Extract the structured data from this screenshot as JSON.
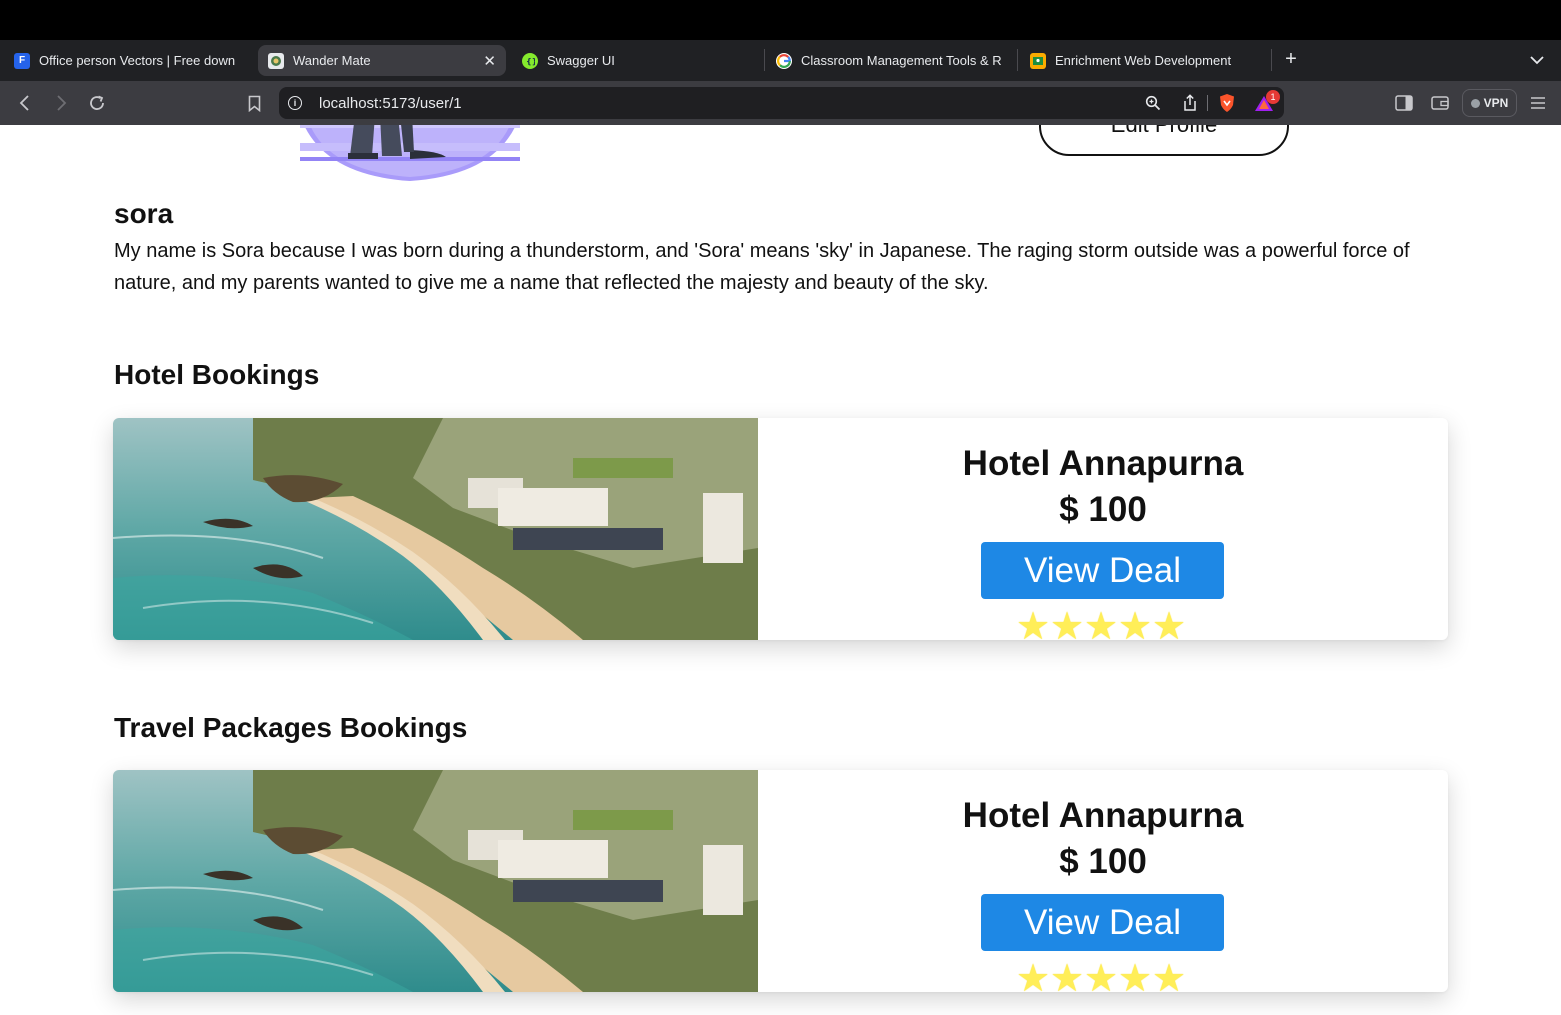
{
  "browser": {
    "tabs": [
      {
        "title": "Office person Vectors | Free down",
        "active": false,
        "favicon": "freepik-icon"
      },
      {
        "title": "Wander Mate",
        "active": true,
        "favicon": "wandermate-icon"
      },
      {
        "title": "Swagger UI",
        "active": false,
        "favicon": "swagger-icon"
      },
      {
        "title": "Classroom Management Tools & R",
        "active": false,
        "favicon": "google-icon"
      },
      {
        "title": "Enrichment Web Development",
        "active": false,
        "favicon": "classroom-icon"
      }
    ],
    "url": "localhost:5173/user/1",
    "notification_count": "1",
    "vpn_label": "VPN"
  },
  "profile": {
    "edit_button_label": "Edit Profile",
    "username": "sora",
    "bio": "My name is Sora because I was born during a thunderstorm, and 'Sora' means 'sky' in Japanese. The raging storm outside was a powerful force of nature, and my parents wanted to give me a name that reflected the majesty and beauty of the sky."
  },
  "sections": {
    "hotel_bookings": {
      "title": "Hotel Bookings",
      "items": [
        {
          "name": "Hotel Annapurna",
          "price": "$ 100",
          "button_label": "View Deal",
          "rating": 5,
          "max_rating": 5
        }
      ]
    },
    "travel_packages": {
      "title": "Travel Packages Bookings",
      "items": [
        {
          "name": "Hotel Annapurna",
          "price": "$ 100",
          "button_label": "View Deal",
          "rating": 5,
          "max_rating": 5
        }
      ]
    }
  },
  "colors": {
    "button_blue": "#1e88e5",
    "star_yellow": "#ffee58",
    "avatar_purple": "#a99bfa",
    "chrome_dark": "#202124"
  }
}
